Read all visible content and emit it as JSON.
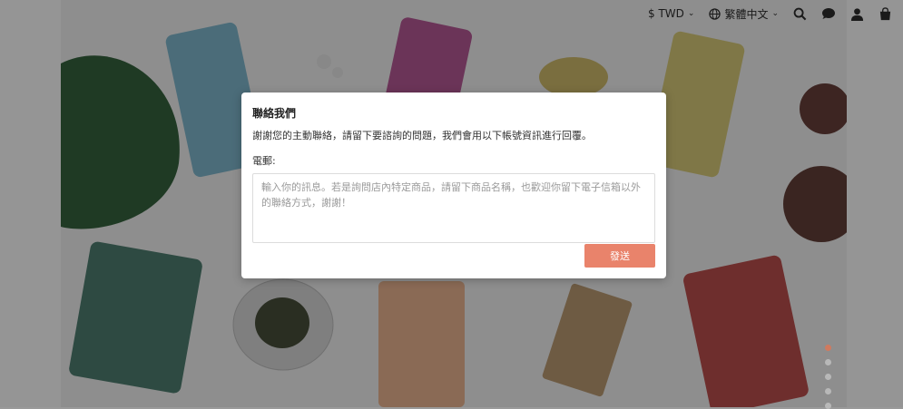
{
  "nav": {
    "currency": "$ TWD",
    "language": "繁體中文",
    "icons": [
      "globe-icon",
      "search-icon",
      "chat-icon",
      "user-icon",
      "bag-icon"
    ]
  },
  "modal": {
    "title": "聯絡我們",
    "description": "謝謝您的主動聯絡，請留下要諮詢的問題，我們會用以下帳號資訊進行回覆。",
    "email_label": "電郵:",
    "message_placeholder": "輸入你的訊息。若是詢問店內特定商品，請留下商品名稱，也歡迎你留下電子信箱以外的聯絡方式，謝謝！",
    "send_label": "發送"
  },
  "carousel": {
    "slides": 5,
    "active_index": 0
  },
  "colors": {
    "accent": "#e9836b",
    "overlay": "rgba(0,0,0,0.45)"
  }
}
